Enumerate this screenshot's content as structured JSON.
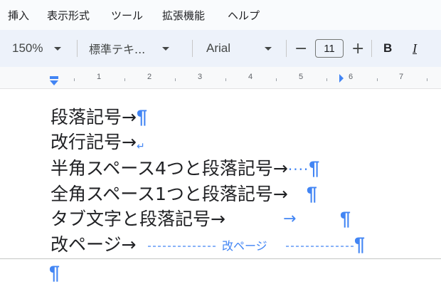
{
  "menu": {
    "items": [
      "挿入",
      "表示形式",
      "ツール",
      "拡張機能",
      "ヘルプ"
    ]
  },
  "toolbar": {
    "zoom": "150%",
    "style": "標準テキ...",
    "font": "Arial",
    "font_size": "11",
    "minus": "−",
    "plus": "+",
    "bold": "B",
    "italic": "I"
  },
  "ruler": {
    "labels": [
      "1",
      "2",
      "3",
      "4",
      "5",
      "6",
      "7"
    ]
  },
  "document": {
    "line1": "段落記号→",
    "line2": "改行記号→",
    "line3": "半角スペース4つと段落記号→",
    "line3_dots": "····",
    "line4": "全角スペース1つと段落記号→",
    "line5": "タブ文字と段落記号→",
    "line6": "改ページ→",
    "page_break_label": "改ページ",
    "pilcrow": "¶",
    "return_mark": "↵",
    "tab_arrow": "→"
  },
  "colors": {
    "formatting_mark": "#4285f4",
    "menubar_bg": "#f9fbfd",
    "toolbar_bg": "#edf2fa"
  }
}
